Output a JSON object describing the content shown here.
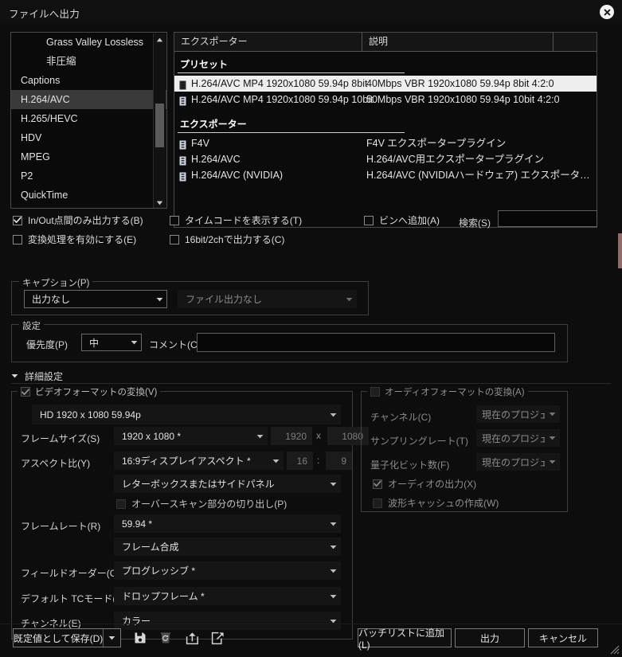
{
  "window": {
    "title": "ファイルへ出力",
    "close_icon": "close-icon"
  },
  "categories": {
    "items": [
      {
        "label": "Grass Valley Lossless",
        "sub": true,
        "selected": false
      },
      {
        "label": "非圧縮",
        "sub": true,
        "selected": false
      },
      {
        "label": "Captions",
        "sub": false,
        "selected": false
      },
      {
        "label": "H.264/AVC",
        "sub": false,
        "selected": true
      },
      {
        "label": "H.265/HEVC",
        "sub": false,
        "selected": false
      },
      {
        "label": "HDV",
        "sub": false,
        "selected": false
      },
      {
        "label": "MPEG",
        "sub": false,
        "selected": false
      },
      {
        "label": "P2",
        "sub": false,
        "selected": false
      },
      {
        "label": "QuickTime",
        "sub": false,
        "selected": false
      }
    ]
  },
  "exporter_panel": {
    "columns": [
      "エクスポーター",
      "説明",
      ""
    ],
    "preset_group": "プリセット",
    "presets": [
      {
        "name": "H.264/AVC MP4 1920x1080 59.94p 8bit",
        "desc": "40Mbps VBR 1920x1080 59.94p 8bit 4:2:0",
        "selected": true
      },
      {
        "name": "H.264/AVC MP4 1920x1080 59.94p 10bit",
        "desc": "50Mbps VBR 1920x1080 59.94p 10bit 4:2:0",
        "selected": false
      }
    ],
    "exporter_group": "エクスポーター",
    "exporters": [
      {
        "name": "F4V",
        "desc": "F4V エクスポータープラグイン"
      },
      {
        "name": "H.264/AVC",
        "desc": "H.264/AVC用エクスポータープラグイン"
      },
      {
        "name": "H.264/AVC (NVIDIA)",
        "desc": "H.264/AVC (NVIDIAハードウェア) エクスポータ…"
      }
    ]
  },
  "options": {
    "inout_only": {
      "label": "In/Out点間のみ出力する(B)",
      "checked": true
    },
    "enable_conv": {
      "label": "変換処理を有効にする(E)",
      "checked": false
    },
    "show_tc": {
      "label": "タイムコードを表示する(T)",
      "checked": false
    },
    "out_16bit2ch": {
      "label": "16bit/2chで出力する(C)",
      "checked": false
    },
    "add_to_bin": {
      "label": "ビンへ追加(A)",
      "checked": false
    },
    "search_label": "検索(S)",
    "search_value": "",
    "search_placeholder": ""
  },
  "caption": {
    "group": "キャプション(P)",
    "mode": "出力なし",
    "file": "ファイル出力なし"
  },
  "settings": {
    "group": "設定",
    "priority_label": "優先度(P)",
    "priority_value": "中",
    "comment_label": "コメント(C)",
    "comment_value": "",
    "comment_placeholder": ""
  },
  "advanced": {
    "title": "詳細設定",
    "expanded": true,
    "chevron_icon": "chevron-down-icon"
  },
  "video": {
    "group": "ビデオフォーマットの変換(V)",
    "enabled": true,
    "format_preset": "HD 1920 x 1080 59.94p",
    "frame_size_label": "フレームサイズ(S)",
    "frame_size_value": "1920 x 1080 *",
    "frame_width": "1920",
    "frame_height": "1080",
    "frame_size_sep": "x",
    "aspect_label": "アスペクト比(Y)",
    "aspect_value": "16:9ディスプレイアスペクト *",
    "aspect_num": "16",
    "aspect_sep": ":",
    "aspect_den": "9",
    "letterbox_value": "レターボックスまたはサイドパネル",
    "overscan": {
      "label": "オーバースキャン部分の切り出し(P)",
      "checked": false
    },
    "framerate_label": "フレームレート(R)",
    "framerate_value": "59.94 *",
    "frame_blend_value": "フレーム合成",
    "fieldorder_label": "フィールドオーダー(O)",
    "fieldorder_value": "プログレッシブ *",
    "tcmode_label": "デフォルト TCモード(D)",
    "tcmode_value": "ドロップフレーム *",
    "channel_label": "チャンネル(E)",
    "channel_value": "カラー"
  },
  "audio": {
    "group": "オーディオフォーマットの変換(A)",
    "enabled": false,
    "channel_label": "チャンネル(C)",
    "channel_value": "現在のプロジェクト設定",
    "samplerate_label": "サンプリングレート(T)",
    "samplerate_value": "現在のプロジェクト設…",
    "bitdepth_label": "量子化ビット数(F)",
    "bitdepth_value": "現在のプロジェクト設…",
    "audio_out": {
      "label": "オーディオの出力(X)",
      "checked": true
    },
    "waveform_cache": {
      "label": "波形キャッシュの作成(W)",
      "checked": false
    }
  },
  "footer": {
    "save_default": "既定値として保存(D)",
    "icons": [
      "save-icon",
      "delete-icon",
      "import-icon",
      "export-icon"
    ],
    "add_batch": "バッチリストに追加(L)",
    "export": "出力",
    "cancel": "キャンセル"
  }
}
